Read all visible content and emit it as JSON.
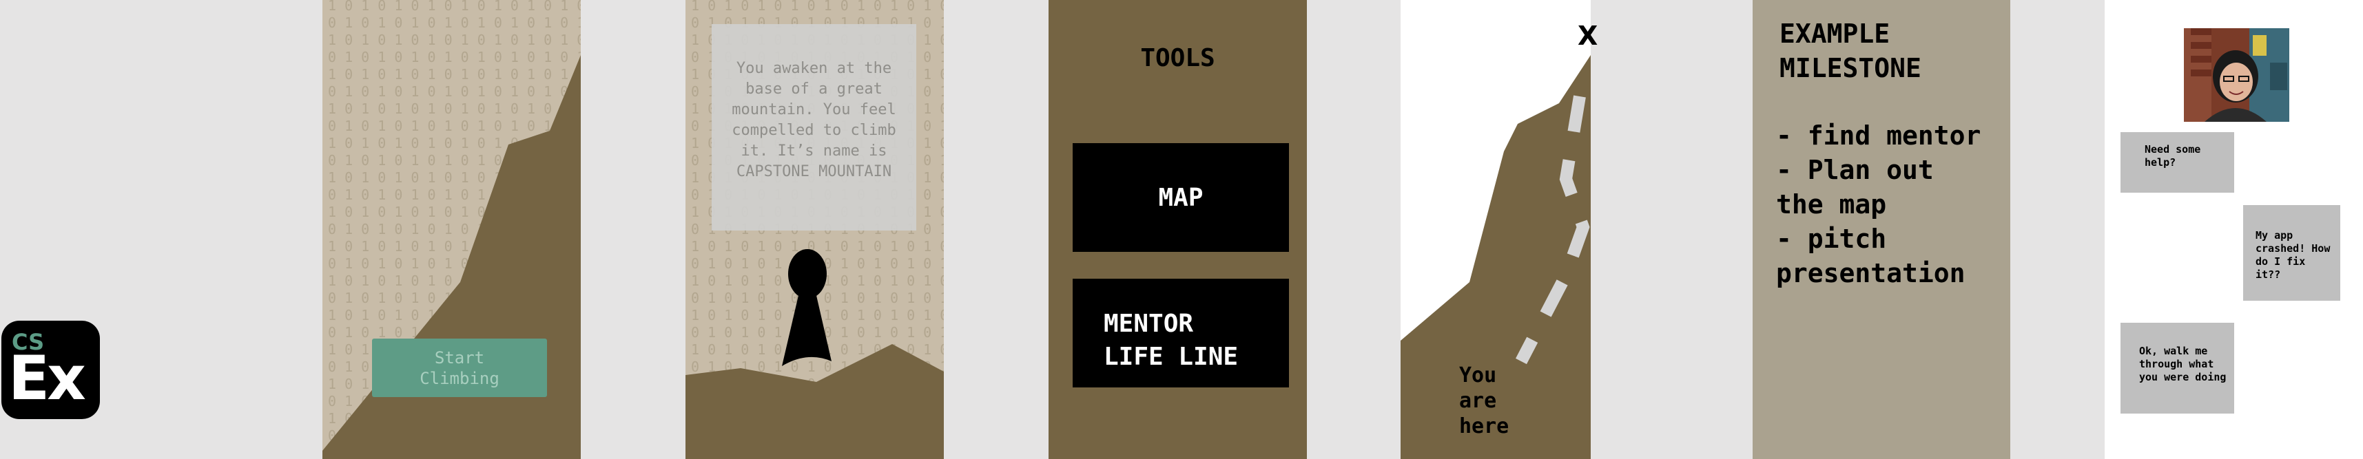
{
  "logo": {
    "top": "CS",
    "bottom": "Ex"
  },
  "screen1": {
    "start_button": "Start\nClimbing"
  },
  "screen2": {
    "story": "You awaken at the base of a great mountain. You feel compelled to climb it. It’s name is CAPSTONE MOUNTAIN"
  },
  "screen3": {
    "title": "TOOLS",
    "map_button": "MAP",
    "mentor_button": "MENTOR\nLIFE LINE"
  },
  "screen4": {
    "close": "X",
    "location_label": "You\nare\nhere"
  },
  "screen5": {
    "title": "EXAMPLE\nMILESTONE",
    "milestones": "- find mentor\n- Plan out\nthe map\n- pitch\npresentation"
  },
  "screen6": {
    "messages": [
      {
        "text": "Need some help?"
      },
      {
        "text": "My app crashed! How do I fix it??"
      },
      {
        "text": "Ok, walk me through what you were doing"
      }
    ]
  },
  "colors": {
    "background": "#e5e4e4",
    "mountain": "#756443",
    "binary_bg": "#c8bca8",
    "accent_green": "#5e9c86",
    "milestone_bg": "#aaa28f",
    "bubble": "#bfbfbf"
  }
}
